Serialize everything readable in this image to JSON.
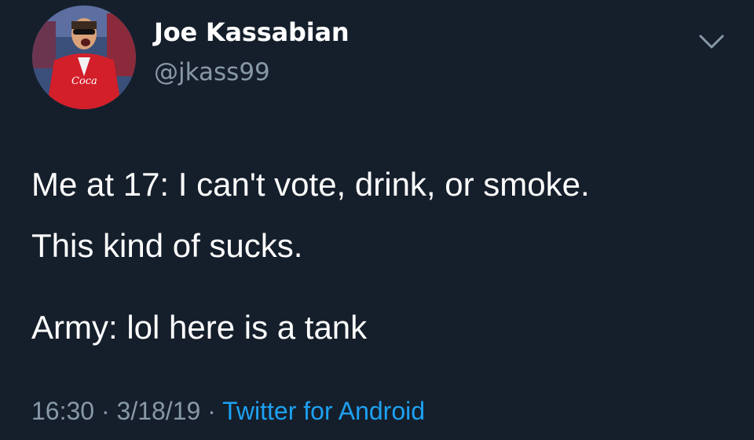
{
  "colors": {
    "background": "#151f2b",
    "text": "#ffffff",
    "secondary": "#8899a6",
    "link": "#1da1f2"
  },
  "author": {
    "display_name": "Joe Kassabian",
    "handle": "@jkass99",
    "avatar_icon": "avatar-photo"
  },
  "menu_icon": "chevron-down-icon",
  "tweet": {
    "lines": [
      "Me at 17: I can't vote, drink, or smoke.",
      "This kind of sucks.",
      "Army: lol here is a tank"
    ]
  },
  "meta": {
    "time": "16:30",
    "separator": " · ",
    "date": "3/18/19",
    "source": "Twitter for Android"
  }
}
